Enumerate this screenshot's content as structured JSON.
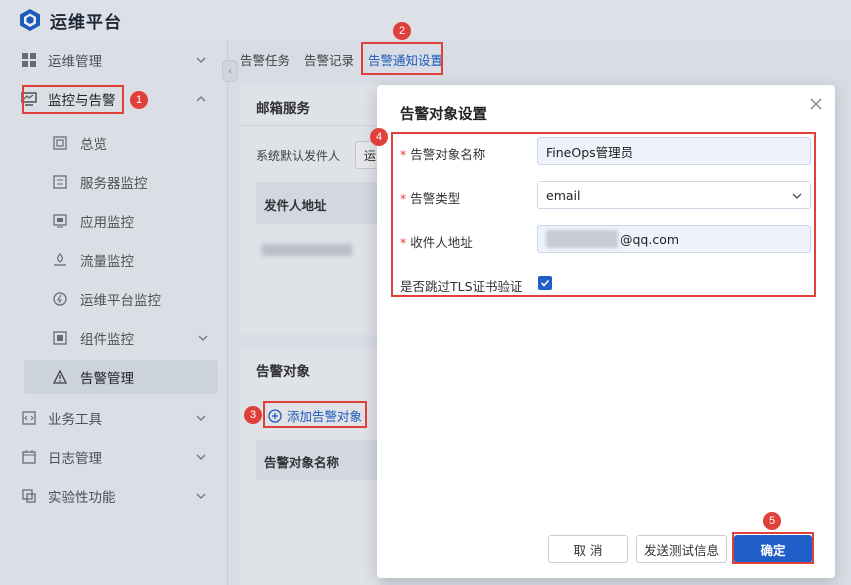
{
  "app": {
    "title": "运维平台",
    "logo_icon": "cube-logo-icon"
  },
  "sidebar": {
    "items": [
      {
        "label": "运维管理",
        "icon": "grid-icon",
        "expanded": false
      },
      {
        "label": "监控与告警",
        "icon": "monitor-icon",
        "expanded": true,
        "children": [
          {
            "label": "总览",
            "icon": "overview-icon"
          },
          {
            "label": "服务器监控",
            "icon": "server-icon"
          },
          {
            "label": "应用监控",
            "icon": "app-icon"
          },
          {
            "label": "流量监控",
            "icon": "traffic-icon"
          },
          {
            "label": "运维平台监控",
            "icon": "platform-icon"
          },
          {
            "label": "组件监控",
            "icon": "component-icon"
          },
          {
            "label": "告警管理",
            "icon": "warning-icon",
            "active": true
          }
        ]
      },
      {
        "label": "业务工具",
        "icon": "code-icon",
        "expanded": false
      },
      {
        "label": "日志管理",
        "icon": "calendar-icon",
        "expanded": false
      },
      {
        "label": "实验性功能",
        "icon": "experiment-icon",
        "expanded": false
      }
    ]
  },
  "tabs": [
    {
      "label": "告警任务"
    },
    {
      "label": "告警记录"
    },
    {
      "label": "告警通知设置",
      "active": true
    }
  ],
  "mail_section": {
    "title": "邮箱服务",
    "default_sender_label": "系统默认发件人",
    "default_sender_value": "运",
    "column_header": "发件人地址"
  },
  "target_section": {
    "title": "告警对象",
    "add_button": "添加告警对象",
    "column_header": "告警对象名称"
  },
  "modal": {
    "title": "告警对象设置",
    "fields": {
      "name": {
        "label": "告警对象名称",
        "value": "FineOps管理员"
      },
      "type": {
        "label": "告警类型",
        "value": "email"
      },
      "recipient": {
        "label": "收件人地址",
        "value_suffix": "@qq.com"
      },
      "skip_tls": {
        "label": "是否跳过TLS证书验证",
        "checked": true
      }
    },
    "buttons": {
      "cancel": "取 消",
      "send_test": "发送测试信息",
      "confirm": "确定"
    }
  },
  "annotations": [
    "1",
    "2",
    "3",
    "4",
    "5"
  ],
  "colors": {
    "accent": "#1f5fc7",
    "annotation": "#e0403a"
  }
}
